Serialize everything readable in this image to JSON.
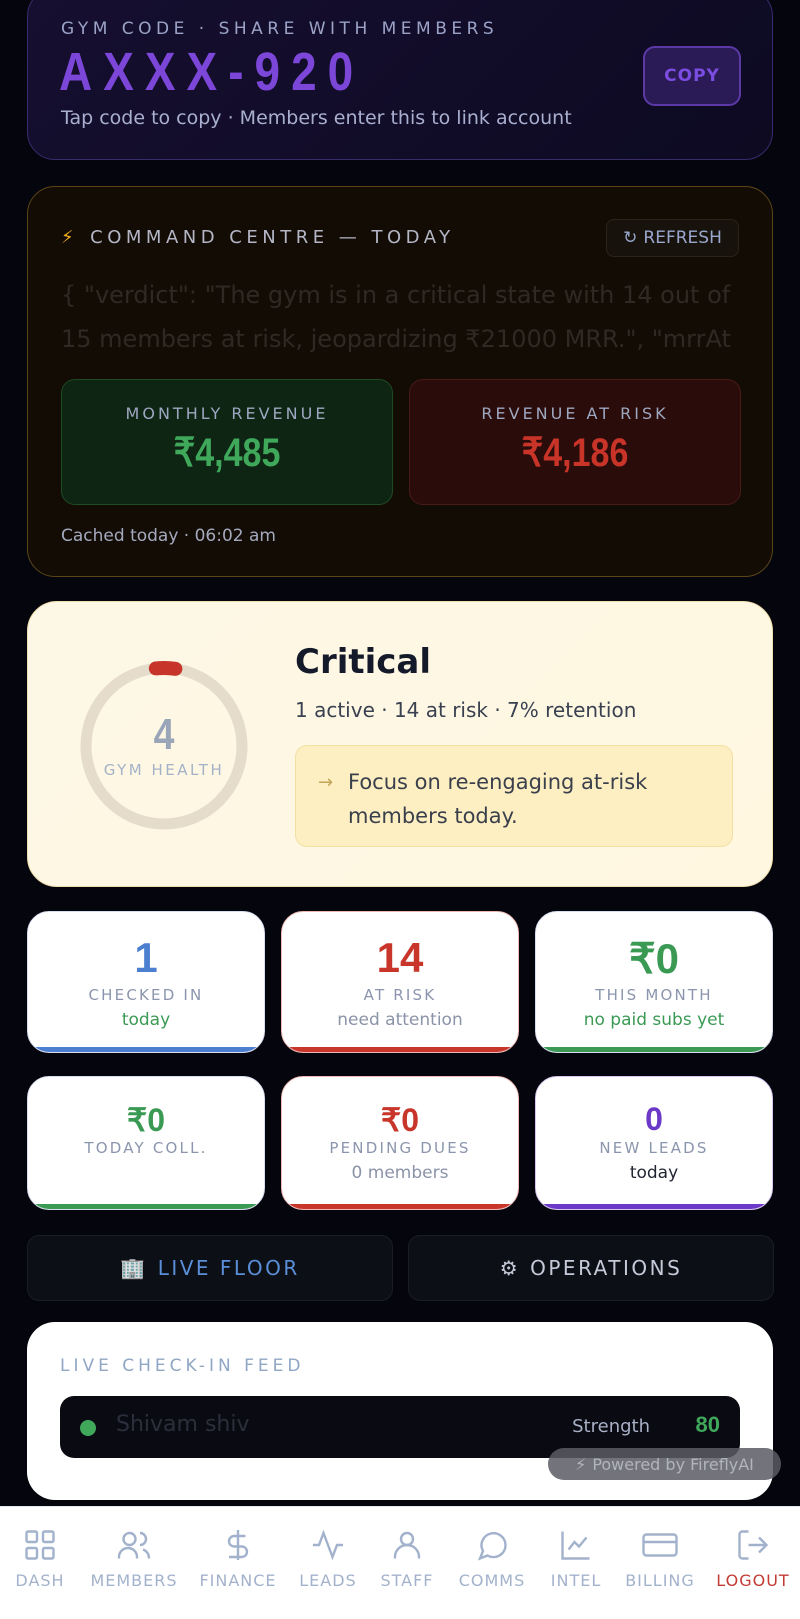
{
  "gym_code": {
    "label": "GYM CODE · SHARE WITH MEMBERS",
    "code": "AXXX-920",
    "subtitle": "Tap code to copy · Members enter this to link account",
    "copy_label": "COPY"
  },
  "command_centre": {
    "title": "COMMAND CENTRE — TODAY",
    "bolt": "⚡",
    "refresh_label": "REFRESH",
    "refresh_glyph": "↻",
    "verdict_text": "{ \"verdict\": \"The gym is in a critical state with 14 out of 15 members at risk, jeopardizing ₹21000 MRR.\", \"mrrAt",
    "monthly_revenue": {
      "label": "MONTHLY REVENUE",
      "value": "₹4,485"
    },
    "revenue_at_risk": {
      "label": "REVENUE AT RISK",
      "value": "₹4,186"
    },
    "cached": "Cached today · 06:02 am"
  },
  "health": {
    "score": "4",
    "score_fraction": 0.04,
    "label": "GYM HEALTH",
    "status": "Critical",
    "summary": "1 active · 14 at risk · 7% retention",
    "focus_arrow": "→",
    "focus": "Focus on re-engaging at-risk members today."
  },
  "stats_row1": [
    {
      "value": "1",
      "label": "CHECKED IN",
      "sub": "today"
    },
    {
      "value": "14",
      "label": "AT RISK",
      "sub": "need attention"
    },
    {
      "value": "₹0",
      "label": "THIS MONTH",
      "sub": "no paid subs yet"
    }
  ],
  "stats_row2": [
    {
      "value": "₹0",
      "label": "TODAY COLL.",
      "sub": ""
    },
    {
      "value": "₹0",
      "label": "PENDING DUES",
      "sub": "0 members"
    },
    {
      "value": "0",
      "label": "NEW LEADS",
      "sub": "today"
    }
  ],
  "tabs": {
    "live_floor": {
      "icon": "🏢",
      "label": "LIVE FLOOR"
    },
    "operations": {
      "icon": "⚙",
      "label": "OPERATIONS"
    }
  },
  "feed": {
    "title": "LIVE CHECK-IN FEED",
    "items": [
      {
        "name": "Shivam shiv",
        "type": "Strength",
        "score": "80"
      }
    ]
  },
  "powered_by": {
    "bolt": "⚡",
    "text": "Powered by FireflyAI"
  },
  "nav": [
    {
      "label": "DASH",
      "icon": "grid-icon"
    },
    {
      "label": "MEMBERS",
      "icon": "users-icon"
    },
    {
      "label": "FINANCE",
      "icon": "dollar-icon"
    },
    {
      "label": "LEADS",
      "icon": "activity-icon"
    },
    {
      "label": "STAFF",
      "icon": "user-icon"
    },
    {
      "label": "COMMS",
      "icon": "message-icon"
    },
    {
      "label": "INTEL",
      "icon": "chart-icon"
    },
    {
      "label": "BILLING",
      "icon": "card-icon"
    },
    {
      "label": "LOGOUT",
      "icon": "logout-icon"
    }
  ],
  "colors": {
    "accent_purple": "#7c47d9",
    "green": "#3fa85b",
    "red": "#c8352a",
    "blue": "#4d7fd0",
    "amber": "#f2b01e"
  }
}
